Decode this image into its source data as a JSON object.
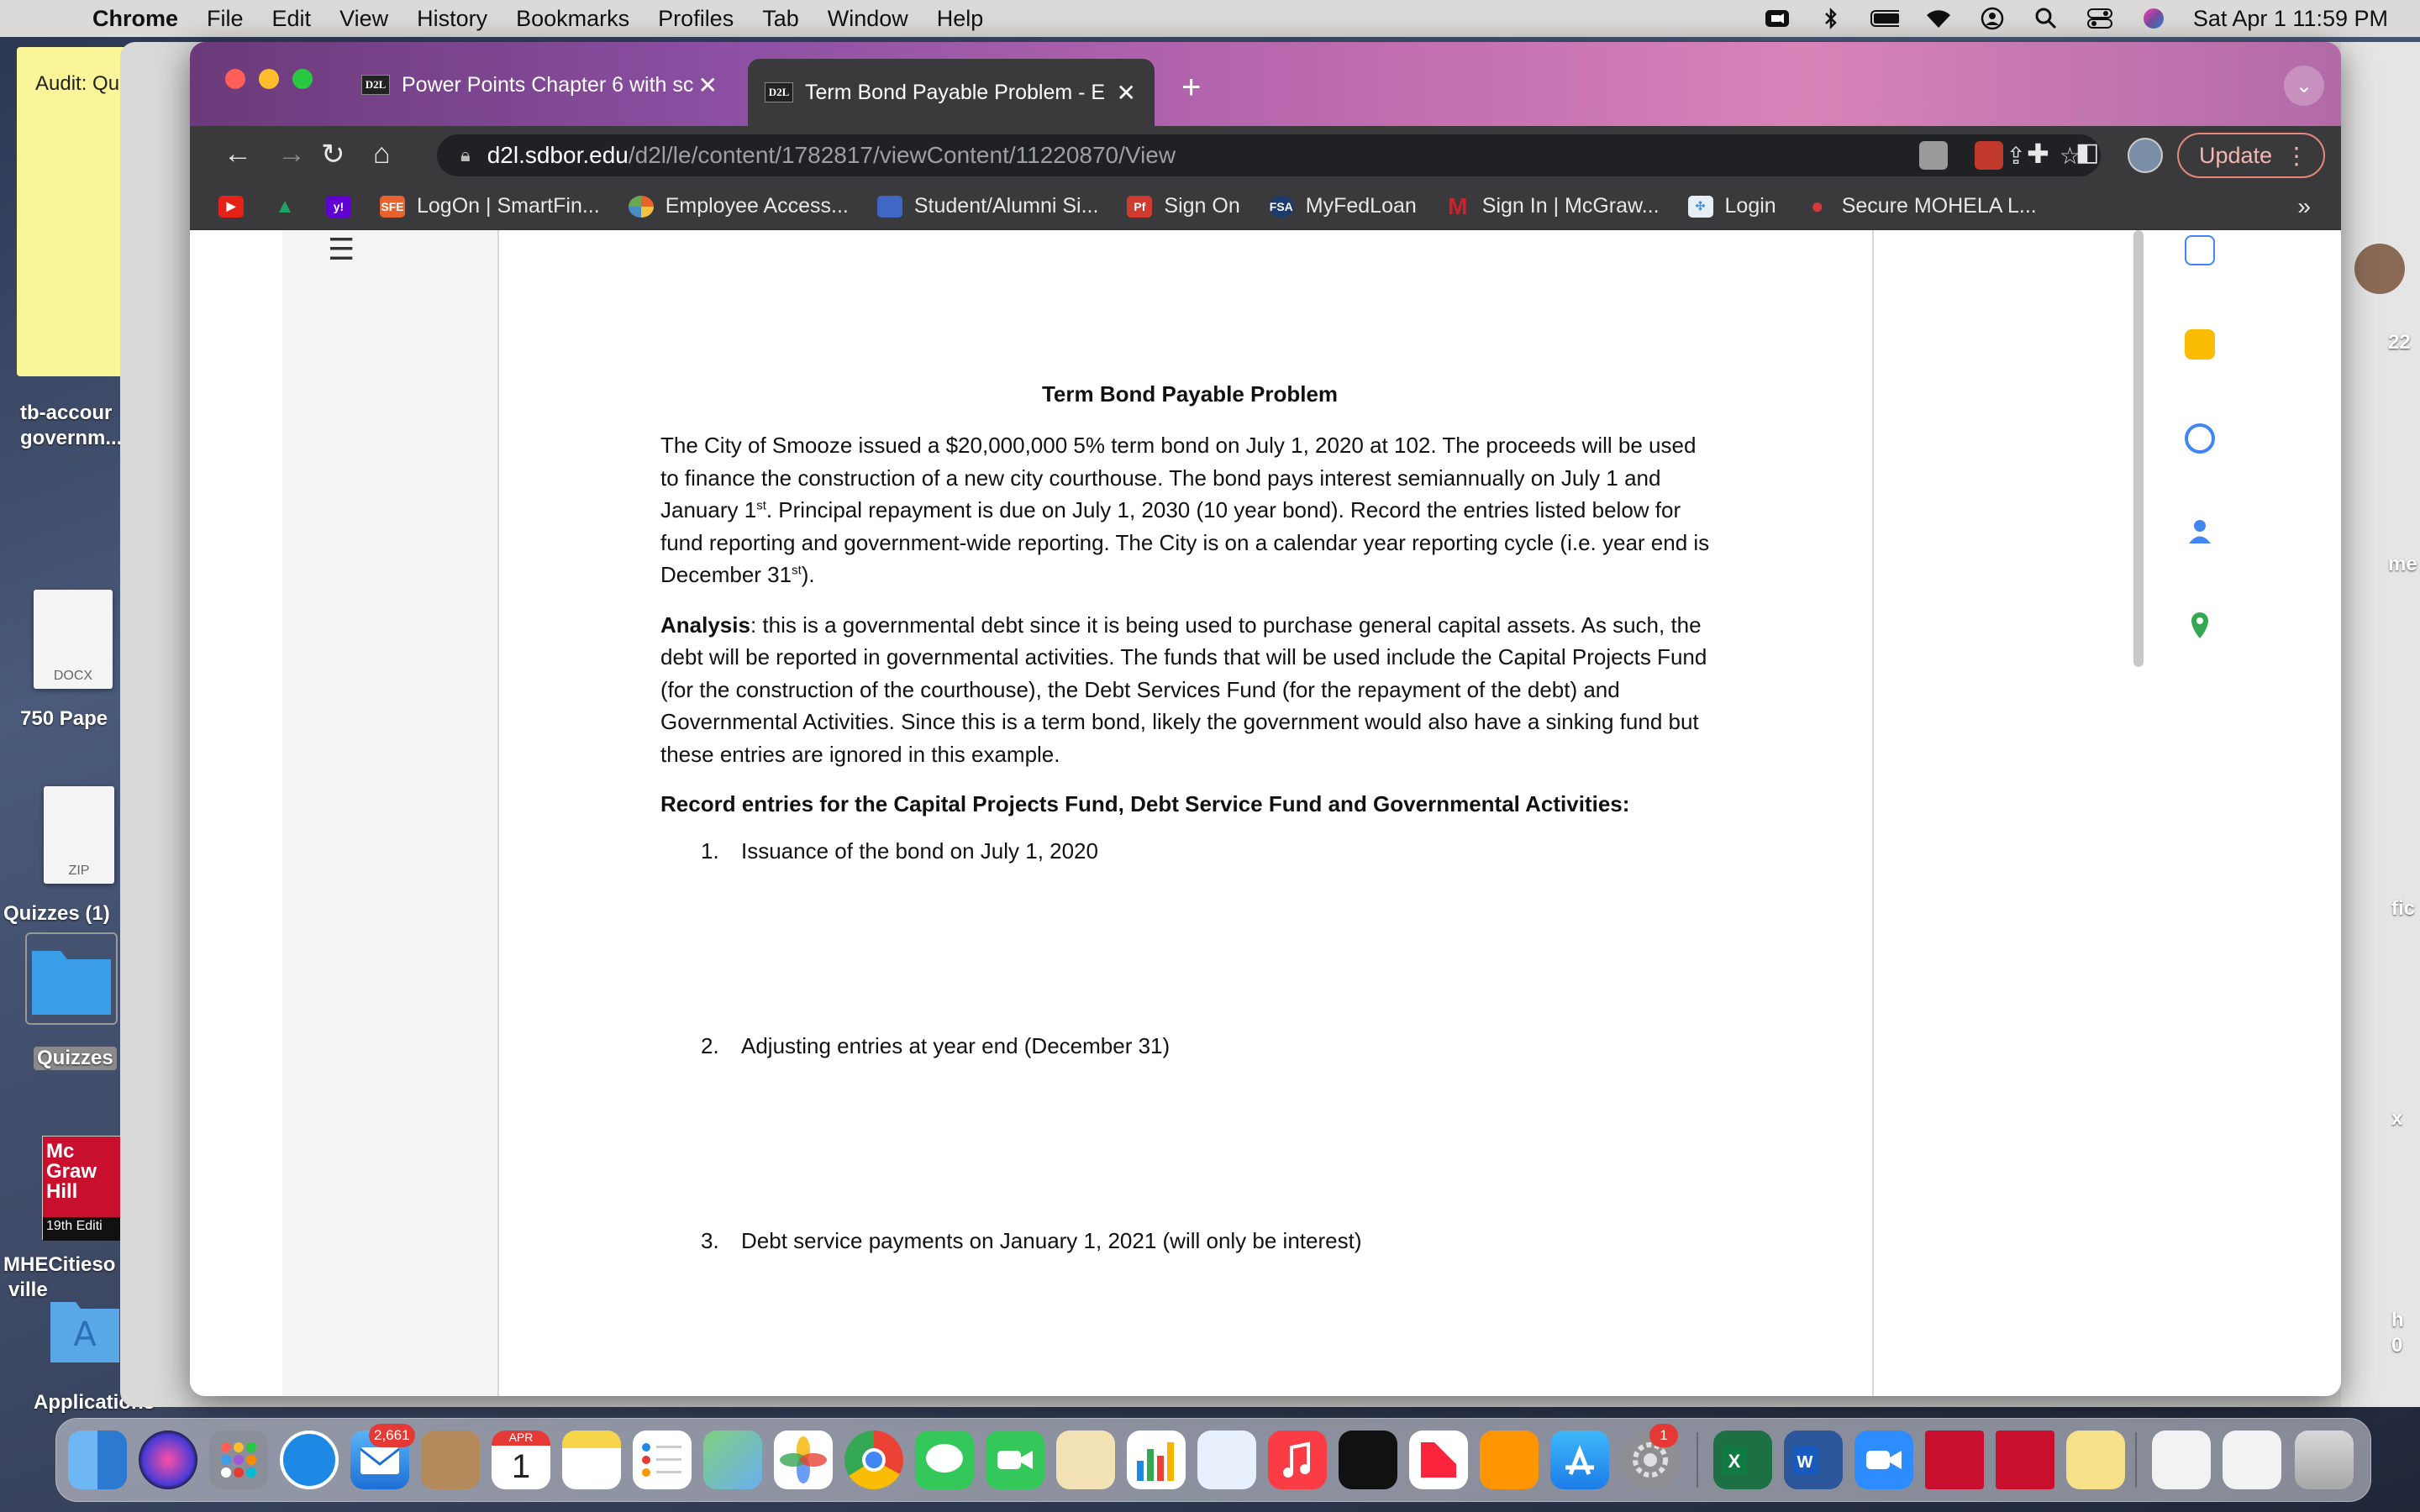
{
  "menubar": {
    "app": "Chrome",
    "items": [
      "File",
      "Edit",
      "View",
      "History",
      "Bookmarks",
      "Profiles",
      "Tab",
      "Window",
      "Help"
    ],
    "datetime": "Sat Apr 1  11:59 PM"
  },
  "desktop": {
    "sticky_text": "Audit: Qu",
    "labels": {
      "tb_account": "tb-accour",
      "tb_account2": "governm...",
      "paper": "750 Pape",
      "quizzes1": "Quizzes (1)",
      "quizzes": "Quizzes",
      "mhe": "MHECitieso",
      "mhe2": "ville",
      "applications": "Applications",
      "right_22": "22",
      "right_me": "me",
      "right_fic": "fic",
      "right_x": "x",
      "right_h": "h",
      "right_o": "0",
      "docx": "DOCX",
      "zip": "ZIP",
      "mh_cover": "Mc Graw Hill",
      "mh_edition": "19th Editi"
    }
  },
  "browser": {
    "tabs": [
      {
        "favicon": "D2L",
        "title": "Power Points Chapter 6 with sc"
      },
      {
        "favicon": "D2L",
        "title": "Term Bond Payable Problem - E"
      }
    ],
    "active_tab": 1,
    "url_host": "d2l.sdbor.edu",
    "url_path": "/d2l/le/content/1782817/viewContent/11220870/View",
    "update_label": "Update",
    "bookmarks": [
      {
        "label": "",
        "icon": "youtube-icon",
        "color": "#e62117"
      },
      {
        "label": "",
        "icon": "drive-icon",
        "color": "#1fa463"
      },
      {
        "label": "",
        "icon": "yahoo-icon",
        "color": "#6001d2"
      },
      {
        "label": "LogOn | SmartFin...",
        "icon": "sfe-icon",
        "color": "#e8632b"
      },
      {
        "label": "Employee Access...",
        "icon": "pie-icon",
        "color": "#4a8bc2"
      },
      {
        "label": "Student/Alumni Si...",
        "icon": "square-icon",
        "color": "#3f68c6"
      },
      {
        "label": "Sign On",
        "icon": "pf-icon",
        "color": "#d13a2f"
      },
      {
        "label": "MyFedLoan",
        "icon": "fsa-icon",
        "color": "#1d3c6d"
      },
      {
        "label": "Sign In | McGraw...",
        "icon": "m-icon",
        "color": "#d21f2b"
      },
      {
        "label": "Login",
        "icon": "login-icon",
        "color": "#4a90d9"
      },
      {
        "label": "Secure MOHELA L...",
        "icon": "apple-icon",
        "color": "#d93838"
      }
    ],
    "bookmarks_more": "»"
  },
  "document": {
    "title": "Term Bond Payable Problem",
    "para1_a": "The City of Smooze issued a $20,000,000 5% term bond on July 1, 2020 at 102. The proceeds will be used to finance the construction of a new city courthouse. The bond pays interest semiannually on July 1 and January 1",
    "para1_sup1": "st",
    "para1_b": ".  Principal repayment is due on July 1, 2030 (10 year bond). Record the entries listed below for fund reporting and government-wide reporting. The City is on a calendar year reporting cycle (i.e. year end is December 31",
    "para1_sup2": "st",
    "para1_c": ").",
    "analysis_label": "Analysis",
    "analysis_text": ": this is a governmental debt since it is being used to purchase general capital assets. As such, the debt will be reported in governmental activities. The funds that will be used include the Capital Projects Fund (for the construction of the courthouse), the Debt Services Fund (for the repayment of the debt) and Governmental Activities. Since this is a term bond, likely the government would also have a sinking fund but these entries are ignored in this example.",
    "instructions": "Record entries for the Capital Projects Fund, Debt Service Fund and Governmental Activities:",
    "items": [
      {
        "num": "1.",
        "text": "Issuance of the bond on July 1, 2020"
      },
      {
        "num": "2.",
        "text": "Adjusting entries at year end (December 31)"
      },
      {
        "num": "3.",
        "text": "Debt service payments on January 1, 2021 (will only be interest)"
      }
    ]
  },
  "dock": {
    "mail_badge": "2,661",
    "calendar_month": "APR",
    "calendar_day": "1",
    "settings_badge": "1"
  }
}
